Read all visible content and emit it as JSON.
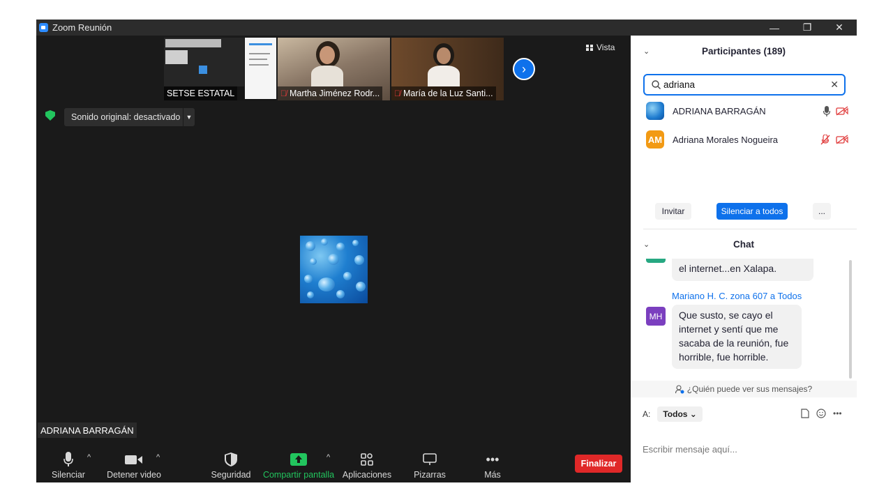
{
  "window": {
    "title": "Zoom Reunión",
    "controls": {
      "minimize": "—",
      "restore": "❐",
      "close": "✕"
    }
  },
  "stage": {
    "thumbnails": [
      {
        "name": "SETSE ESTATAL",
        "muted": false
      },
      {
        "name": "Martha Jiménez Rodr...",
        "muted": true
      },
      {
        "name": "María de la Luz Santi...",
        "muted": true
      }
    ],
    "next_icon": "chevron-right-icon",
    "view_label": "Vista",
    "sound_label": "Sonido original: desactivado",
    "active_speaker": "ADRIANA BARRAGÁN"
  },
  "toolbar": {
    "mute": "Silenciar",
    "video": "Detener video",
    "security": "Seguridad",
    "share": "Compartir pantalla",
    "apps": "Aplicaciones",
    "boards": "Pizarras",
    "more": "Más",
    "end": "Finalizar"
  },
  "participants": {
    "title": "Participantes (189)",
    "search_value": "adriana",
    "items": [
      {
        "name": "ADRIANA BARRAGÁN",
        "initials": "",
        "mic": "on",
        "video": "off"
      },
      {
        "name": "Adriana Morales Nogueira",
        "initials": "AM",
        "mic": "off",
        "video": "off"
      }
    ],
    "invite": "Invitar",
    "mute_all": "Silenciar a todos",
    "more": "..."
  },
  "chat": {
    "title": "Chat",
    "partial_message": "el internet...en Xalapa.",
    "sender": "Mariano H. C. zona 607 a Todos",
    "sender_initials": "MH",
    "message_lines": [
      "Que susto, se cayo el",
      "internet y sentí que me",
      "sacaba de la reunión, fue",
      "horrible, fue horrible."
    ],
    "who_can_see": "¿Quién puede ver sus mensajes?",
    "to_label": "A:",
    "to_value": "Todos",
    "input_placeholder": "Escribir mensaje aquí..."
  },
  "colors": {
    "accent": "#0e71eb",
    "end_button": "#e02828",
    "share_green": "#22c55e",
    "muted_red": "#e03a3a"
  }
}
